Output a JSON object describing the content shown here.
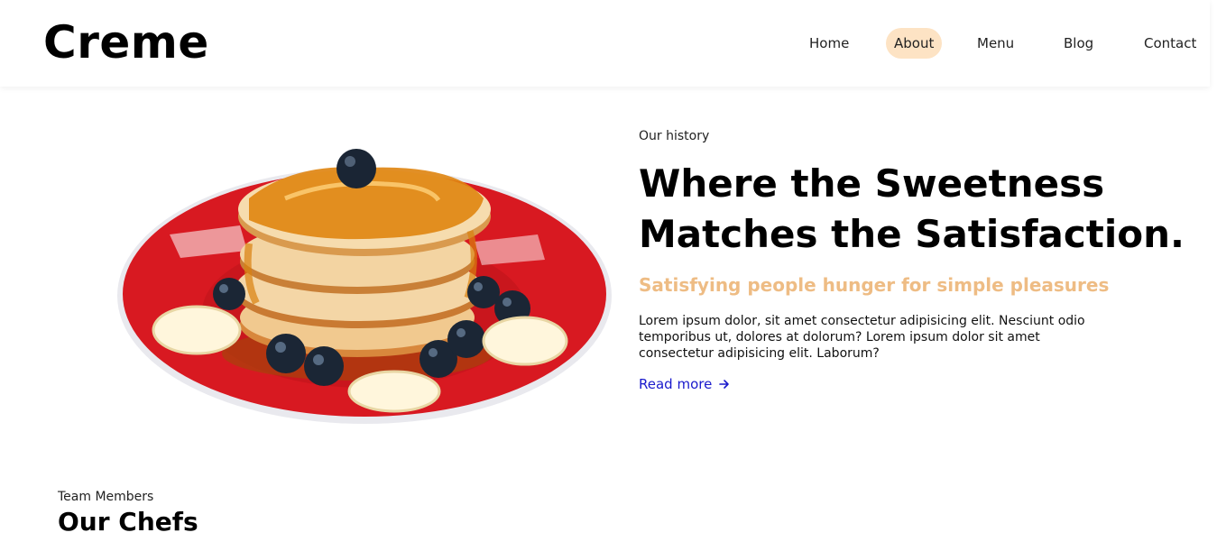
{
  "brand": {
    "name": "Creme"
  },
  "nav": {
    "items": [
      {
        "label": "Home",
        "active": false
      },
      {
        "label": "About",
        "active": true
      },
      {
        "label": "Menu",
        "active": false
      },
      {
        "label": "Blog",
        "active": false
      },
      {
        "label": "Contact",
        "active": false
      }
    ]
  },
  "hero": {
    "eyebrow": "Our history",
    "headline": "Where the Sweetness Matches the Satisfaction.",
    "subheadline": "Satisfying people hunger for simple pleasures",
    "body": "Lorem ipsum dolor, sit amet consectetur adipisicing elit. Nesciunt odio temporibus ut, dolores at dolorum? Lorem ipsum dolor sit amet consectetur adipisicing elit. Laborum?",
    "read_more": "Read more",
    "image_icon": "pancake-stack-image"
  },
  "team": {
    "eyebrow": "Team Members",
    "title": "Our Chefs"
  },
  "colors": {
    "accent": "#eebc84",
    "active_pill": "#fde3c4",
    "link": "#1a1acc"
  }
}
